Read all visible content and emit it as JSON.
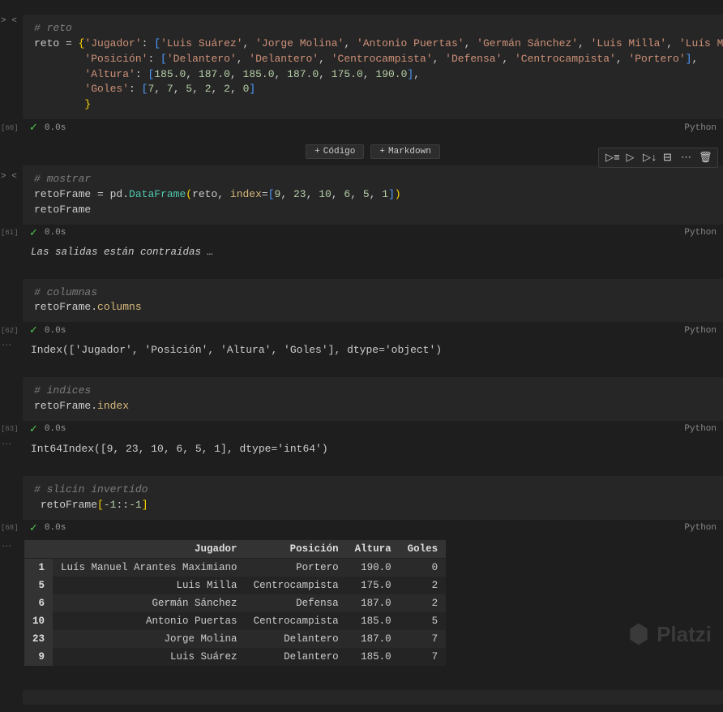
{
  "cells": {
    "c0": {
      "comment": "# reto",
      "assign_var": "reto",
      "equals": " = ",
      "brace_open": "{",
      "k_jugador": "'Jugador'",
      "colon": ": ",
      "list_open": "[",
      "j1": "'Luis Suárez'",
      "j2": "'Jorge Molina'",
      "j3": "'Antonio Puertas'",
      "j4": "'Germán Sánchez'",
      "j5": "'Luis Milla'",
      "j6": "'Luís Manuel Arant",
      "k_posicion": "'Posición'",
      "p1": "'Delantero'",
      "p2": "'Delantero'",
      "p3": "'Centrocampista'",
      "p4": "'Defensa'",
      "p5": "'Centrocampista'",
      "p6": "'Portero'",
      "k_altura": "'Altura'",
      "a1": "185.0",
      "a2": "187.0",
      "a3": "185.0",
      "a4": "187.0",
      "a5": "175.0",
      "a6": "190.0",
      "k_goles": "'Goles'",
      "g1": "7",
      "g2": "7",
      "g3": "5",
      "g4": "2",
      "g5": "2",
      "g6": "0",
      "list_close": "]",
      "comma": ", ",
      "comma2": ",",
      "brace_close": "}",
      "time": "0.0s",
      "lang": "Python",
      "idx": "[60]"
    },
    "c1": {
      "comment": "# mostrar",
      "var": "retoFrame",
      "eq": " = ",
      "pd": "pd",
      "dot": ".",
      "dataframe": "DataFrame",
      "po": "(",
      "arg1": "reto",
      "comma": ", ",
      "kw_index": "index",
      "eq2": "=",
      "lo": "[",
      "i1": "9",
      "i2": "23",
      "i3": "10",
      "i4": "6",
      "i5": "5",
      "i6": "1",
      "lc": "]",
      "pc": ")",
      "line2": "retoFrame",
      "time": "0.0s",
      "lang": "Python",
      "idx": "[61]",
      "collapsed": "Las salidas están contraídas",
      "ellipsis": "…"
    },
    "c2": {
      "comment": "# columnas",
      "var": "retoFrame",
      "dot": ".",
      "attr": "columns",
      "time": "0.0s",
      "lang": "Python",
      "idx": "[62]",
      "output": "Index(['Jugador', 'Posición', 'Altura', 'Goles'], dtype='object')"
    },
    "c3": {
      "comment": "# indices",
      "var": "retoFrame",
      "dot": ".",
      "attr": "index",
      "time": "0.0s",
      "lang": "Python",
      "idx": "[63]",
      "output": "Int64Index([9, 23, 10, 6, 5, 1], dtype='int64')"
    },
    "c4": {
      "comment": "# slicin invertido",
      "indent": " ",
      "var": "retoFrame",
      "bo": "[",
      "s1": "-1",
      "c1": ":",
      "c2": ":",
      "s2": "-1",
      "bc": "]",
      "time": "0.0s",
      "lang": "Python",
      "idx": "[68]"
    }
  },
  "buttons": {
    "codigo": "Código",
    "markdown": "Markdown",
    "plus": "+"
  },
  "table": {
    "headers": [
      "",
      "Jugador",
      "Posición",
      "Altura",
      "Goles"
    ],
    "rows": [
      [
        "1",
        "Luís Manuel Arantes Maximiano",
        "Portero",
        "190.0",
        "0"
      ],
      [
        "5",
        "Luis Milla",
        "Centrocampista",
        "175.0",
        "2"
      ],
      [
        "6",
        "Germán Sánchez",
        "Defensa",
        "187.0",
        "2"
      ],
      [
        "10",
        "Antonio Puertas",
        "Centrocampista",
        "185.0",
        "5"
      ],
      [
        "23",
        "Jorge Molina",
        "Delantero",
        "187.0",
        "7"
      ],
      [
        "9",
        "Luis Suárez",
        "Delantero",
        "185.0",
        "7"
      ]
    ]
  },
  "watermark": "Platzi"
}
